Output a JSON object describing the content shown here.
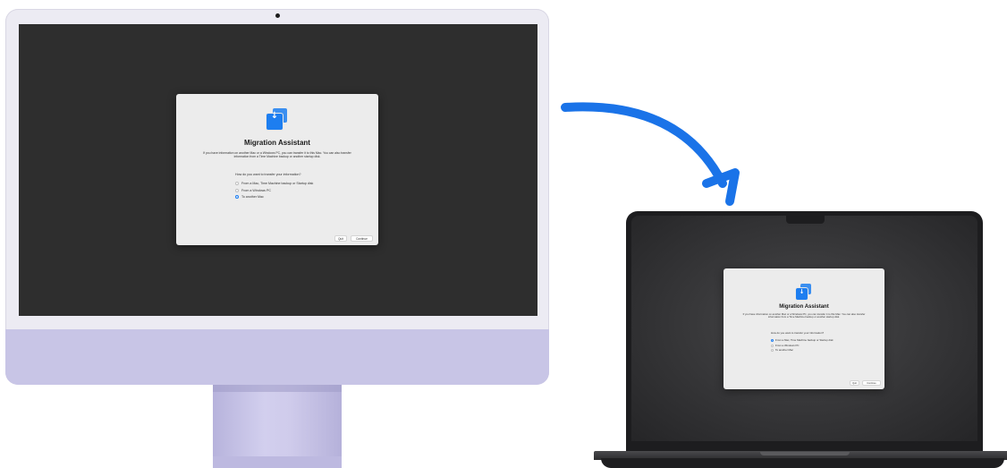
{
  "dialog": {
    "title": "Migration Assistant",
    "description": "If you have information on another Mac or a Windows PC, you can transfer it to this Mac. You can also transfer information from a Time Machine backup or another startup disk.",
    "question": "How do you want to transfer your information?",
    "options": [
      {
        "label": "From a Mac, Time Machine backup or Startup disk"
      },
      {
        "label": "From a Windows PC"
      },
      {
        "label": "To another Mac"
      }
    ],
    "quit_label": "Quit",
    "continue_label": "Continue"
  },
  "imac_selected_option": "To another Mac",
  "macbook_selected_option": "From a Mac, Time Machine backup or Startup disk",
  "colors": {
    "accent": "#1d7ef0",
    "arrow": "#1a73e8",
    "imac_body": "#c8c5e6",
    "macbook_body": "#1d1d1f"
  },
  "icons": {
    "migration": "migration-assistant-icon",
    "transfer_arrow": "curved-arrow-icon"
  }
}
